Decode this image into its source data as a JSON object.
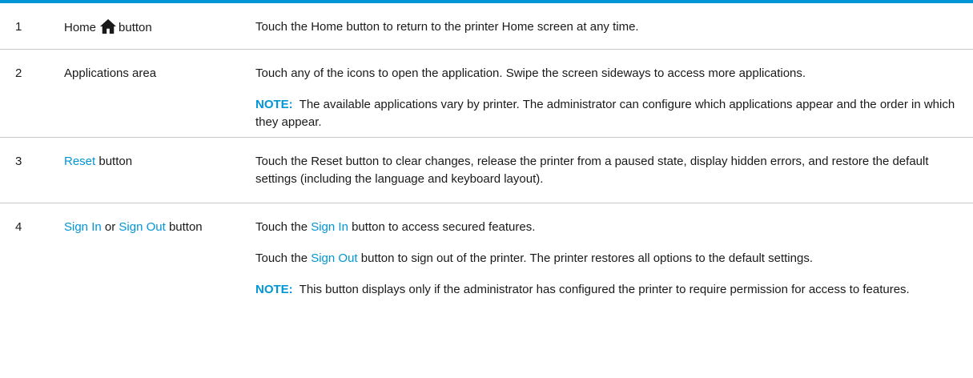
{
  "rows": [
    {
      "num": "1",
      "item_prefix": "Home",
      "item_icon": "home-icon",
      "item_suffix": "button",
      "desc": "Touch the Home button to return to the printer Home screen at any time."
    },
    {
      "num": "2",
      "item": "Applications area",
      "desc": "Touch any of the icons to open the application. Swipe the screen sideways to access more applications.",
      "note_label": "NOTE:",
      "note_text": "The available applications vary by printer. The administrator can configure which applications appear and the order in which they appear."
    },
    {
      "num": "3",
      "item_link": "Reset",
      "item_suffix": "button",
      "desc": "Touch the Reset button to clear changes, release the printer from a paused state, display hidden errors, and restore the default settings (including the language and keyboard layout)."
    },
    {
      "num": "4",
      "item_link1": "Sign In",
      "item_mid": "or",
      "item_link2": "Sign Out",
      "item_suffix": "button",
      "desc1_prefix": "Touch the",
      "desc1_link": "Sign In",
      "desc1_suffix": "button to access secured features.",
      "desc2_prefix": "Touch the",
      "desc2_link": "Sign Out",
      "desc2_suffix": "button to sign out of the printer. The printer restores all options to the default settings.",
      "note_label": "NOTE:",
      "note_text": "This button displays only if the administrator has configured the printer to require permission for access to features."
    }
  ],
  "colors": {
    "accent": "#0096d6",
    "rule": "#c8c8c8",
    "text": "#1a1a1a"
  }
}
